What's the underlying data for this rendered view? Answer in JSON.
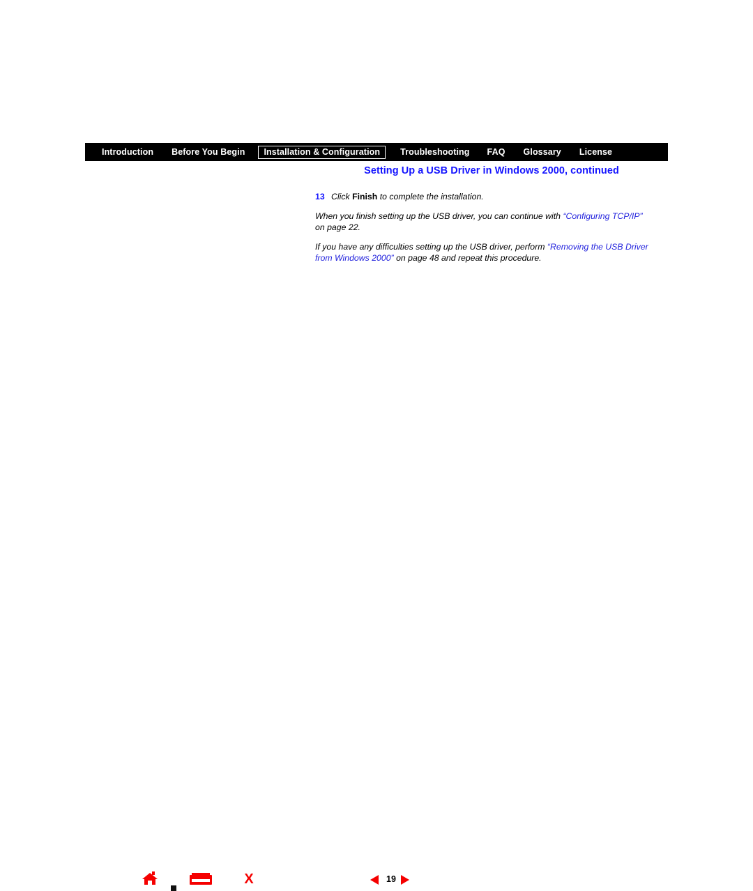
{
  "nav": {
    "tabs": [
      {
        "label": "Introduction",
        "active": false
      },
      {
        "label": "Before You Begin",
        "active": false
      },
      {
        "label": "Installation & Configuration",
        "active": true
      },
      {
        "label": "Troubleshooting",
        "active": false
      },
      {
        "label": "FAQ",
        "active": false
      },
      {
        "label": "Glossary",
        "active": false
      },
      {
        "label": "License",
        "active": false
      }
    ],
    "bar_color": "#000000",
    "text_color": "#ffffff"
  },
  "heading": {
    "text": "Setting Up a USB Driver in Windows 2000, continued",
    "color": "#1414ff"
  },
  "content": {
    "step": {
      "number": "13",
      "text_before": "Click ",
      "bold_word": "Finish",
      "text_after": " to complete the installation."
    },
    "paragraph1": {
      "part1": "When you finish setting up the USB driver, you can continue with ",
      "link": "“Configuring TCP/IP”",
      "part2": " on page 22."
    },
    "paragraph2": {
      "part1": "If you have any difficulties setting up the USB driver, perform ",
      "link": "“Removing the USB Driver from Windows 2000”",
      "part2": " on page 48 and repeat this procedure."
    }
  },
  "footer": {
    "home_icon": "home-icon",
    "marker_icon": "square-marker-icon",
    "index_icon": "index-book-icon",
    "exit_icon": "exit-x-icon",
    "exit_glyph": "X",
    "prev_icon": "previous-page-arrow-icon",
    "next_icon": "next-page-arrow-icon",
    "page_number": "19",
    "accent_color": "#f50000"
  }
}
